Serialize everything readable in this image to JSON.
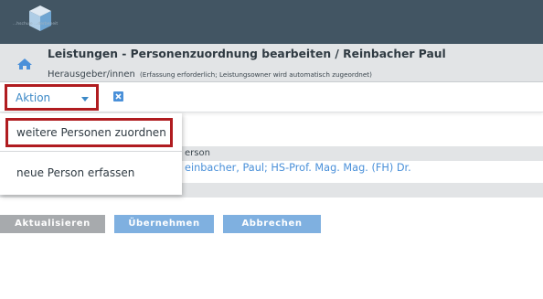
{
  "logo": {
    "text": "...hschule ...derbeneit",
    "icon": "cube-logo"
  },
  "header": {
    "home_icon": "home-icon",
    "title": "Leistungen - Personenzuordnung bearbeiten / Reinbacher Paul",
    "subtitle": "Herausgeber/innen",
    "subtitle_note": "(Erfassung erforderlich; Leistungsowner wird automatisch zugeordnet)"
  },
  "toolbar": {
    "aktion_label": "Aktion",
    "close_icon": "close-icon"
  },
  "dropdown": {
    "items": [
      {
        "label": "weitere Personen zuordnen"
      },
      {
        "label": "neue Person erfassen"
      }
    ]
  },
  "table": {
    "header_fragment": "erson",
    "row_fragment": "einbacher, Paul; HS-Prof. Mag. Mag. (FH) Dr."
  },
  "buttons": {
    "refresh": "Aktualisieren",
    "accept": "Übernehmen",
    "cancel": "Abbrechen"
  },
  "colors": {
    "topbar": "#425563",
    "accent": "#4a90d9",
    "highlight": "#b01c20"
  }
}
